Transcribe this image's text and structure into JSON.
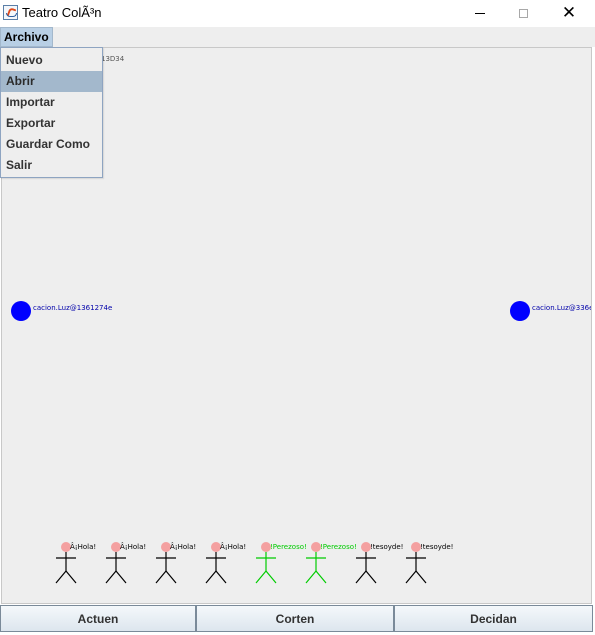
{
  "window": {
    "title": "Teatro ColÃ³n",
    "icon": "java-cup-icon"
  },
  "menubar": {
    "archivo": "Archivo"
  },
  "menu": {
    "items": [
      "Nuevo",
      "Abrir",
      "Importar",
      "Exportar",
      "Guardar Como",
      "Salir"
    ],
    "selected": "Abrir"
  },
  "canvas": {
    "label_partial": "13D34",
    "lights": [
      {
        "label": "cacion.Luz@1361274e",
        "color": "#0000ff"
      },
      {
        "label": "cacion.Luz@336e",
        "color": "#0000ff"
      }
    ],
    "actors": [
      {
        "speech": "Â¡Hola!",
        "color": "#000000"
      },
      {
        "speech": "Â¡Hola!",
        "color": "#000000"
      },
      {
        "speech": "Â¡Hola!",
        "color": "#000000"
      },
      {
        "speech": "Â¡Hola!",
        "color": "#000000"
      },
      {
        "speech": "!Perezoso!",
        "color": "#00cc00"
      },
      {
        "speech": "!Perezoso!",
        "color": "#00cc00"
      },
      {
        "speech": "!tesoyde!",
        "color": "#000000"
      },
      {
        "speech": "!tesoyde!",
        "color": "#000000"
      }
    ],
    "head_color": "#f4a0a0"
  },
  "buttons": {
    "actuen": "Actuen",
    "corten": "Corten",
    "decidan": "Decidan"
  }
}
